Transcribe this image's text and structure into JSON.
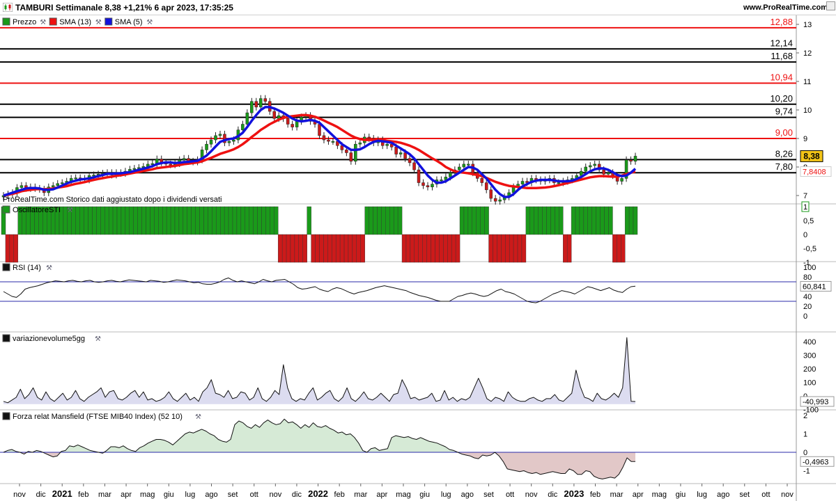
{
  "header": {
    "title": "TAMBURI Settimanale 8,38 +1,21% 6 apr 2023, 17:35:25",
    "site": "www.ProRealTime.com"
  },
  "colors": {
    "red": "#ee1111",
    "blue": "#1111dd",
    "up": "#1a9a1a",
    "down": "#cc1a1a",
    "price_tag_bg": "#f2c418",
    "vol_fill": "#dcdcf0",
    "pos_fill": "#d6ead6",
    "neg_fill": "#e2c8c8"
  },
  "panels": {
    "price": {
      "legend": [
        {
          "icon": "candlestick-icon",
          "label": "Prezzo"
        },
        {
          "icon": "red-square-icon",
          "label": "SMA (13)"
        },
        {
          "icon": "blue-square-icon",
          "label": "SMA (5)"
        }
      ],
      "note": "ProRealTime.com Storico dati aggiustato dopo i dividendi versati"
    },
    "sti": {
      "label": "OscillatoreSTI",
      "tag": "1"
    },
    "rsi": {
      "label": "RSI (14)",
      "tag": "60,841"
    },
    "vol": {
      "label": "variazionevolume5gg",
      "tag": "-40,993"
    },
    "mansfield": {
      "label": "Forza relat Mansfield (FTSE MIB40 Index) (52 10)",
      "tag": "-0,4963"
    }
  },
  "chart_data": [
    {
      "type": "candlestick",
      "name": "Prezzo",
      "ylim": [
        6.4,
        13.1
      ],
      "y_ticks": [
        "13",
        "12",
        "11",
        "10",
        "9",
        "8",
        "7"
      ],
      "horizontal_levels": [
        {
          "value": 12.88,
          "label": "12,88",
          "color": "red"
        },
        {
          "value": 12.14,
          "label": "12,14",
          "color": "black"
        },
        {
          "value": 11.68,
          "label": "11,68",
          "color": "black"
        },
        {
          "value": 10.94,
          "label": "10,94",
          "color": "red"
        },
        {
          "value": 10.2,
          "label": "10,20",
          "color": "black"
        },
        {
          "value": 9.74,
          "label": "9,74",
          "color": "black"
        },
        {
          "value": 9.0,
          "label": "9,00",
          "color": "red"
        },
        {
          "value": 8.26,
          "label": "8,26",
          "color": "black"
        },
        {
          "value": 7.8,
          "label": "7,80",
          "color": "black"
        }
      ],
      "last_price": "8,38",
      "sma13_last": "7,8408",
      "sma5_last": "7,9420",
      "close": [
        7.0,
        7.05,
        7.1,
        7.28,
        7.35,
        7.25,
        7.3,
        7.25,
        7.22,
        7.1,
        7.3,
        7.35,
        7.42,
        7.45,
        7.5,
        7.6,
        7.62,
        7.6,
        7.55,
        7.7,
        7.72,
        7.75,
        7.78,
        7.8,
        7.72,
        7.8,
        7.78,
        7.85,
        7.92,
        7.95,
        7.98,
        8.02,
        8.1,
        8.12,
        8.28,
        8.15,
        8.1,
        8.08,
        8.12,
        8.25,
        8.3,
        8.2,
        8.18,
        8.25,
        8.6,
        8.8,
        8.95,
        9.1,
        9.15,
        8.85,
        8.9,
        8.95,
        9.3,
        9.5,
        9.9,
        10.3,
        10.1,
        10.4,
        10.3,
        9.95,
        9.7,
        9.8,
        9.7,
        9.5,
        9.4,
        9.6,
        9.75,
        9.8,
        9.6,
        9.5,
        9.1,
        8.95,
        8.9,
        8.9,
        8.75,
        8.6,
        8.5,
        8.2,
        8.8,
        8.85,
        9.05,
        9.0,
        8.85,
        8.95,
        8.75,
        8.8,
        8.7,
        8.45,
        8.5,
        8.3,
        8.15,
        7.9,
        7.45,
        7.35,
        7.3,
        7.4,
        7.55,
        7.55,
        7.65,
        7.8,
        7.9,
        8.0,
        8.1,
        8.1,
        7.8,
        7.6,
        7.45,
        7.2,
        6.9,
        6.8,
        6.85,
        6.95,
        7.1,
        7.3,
        7.4,
        7.5,
        7.45,
        7.6,
        7.55,
        7.5,
        7.55,
        7.6,
        7.45,
        7.45,
        7.5,
        7.55,
        7.6,
        7.7,
        7.85,
        8.0,
        8.05,
        8.1,
        7.9,
        7.75,
        7.8,
        7.7,
        7.5,
        7.6,
        8.25,
        8.2,
        8.38
      ],
      "sma13": [
        7.0,
        7.03,
        7.06,
        7.1,
        7.15,
        7.18,
        7.2,
        7.22,
        7.23,
        7.22,
        7.23,
        7.25,
        7.28,
        7.3,
        7.33,
        7.37,
        7.41,
        7.44,
        7.47,
        7.51,
        7.55,
        7.58,
        7.61,
        7.64,
        7.66,
        7.69,
        7.71,
        7.74,
        7.77,
        7.8,
        7.83,
        7.86,
        7.89,
        7.92,
        7.96,
        7.98,
        8.0,
        8.02,
        8.04,
        8.07,
        8.1,
        8.12,
        8.14,
        8.16,
        8.2,
        8.26,
        8.32,
        8.39,
        8.46,
        8.51,
        8.56,
        8.62,
        8.7,
        8.8,
        8.92,
        9.05,
        9.17,
        9.3,
        9.4,
        9.5,
        9.58,
        9.66,
        9.72,
        9.76,
        9.78,
        9.8,
        9.82,
        9.82,
        9.8,
        9.76,
        9.7,
        9.63,
        9.55,
        9.48,
        9.4,
        9.3,
        9.2,
        9.1,
        9.03,
        8.98,
        8.95,
        8.95,
        8.95,
        8.95,
        8.95,
        8.92,
        8.9,
        8.88,
        8.85,
        8.8,
        8.75,
        8.68,
        8.6,
        8.5,
        8.4,
        8.3,
        8.22,
        8.12,
        8.0,
        7.92,
        7.85,
        7.82,
        7.8,
        7.78,
        7.75,
        7.72,
        7.68,
        7.62,
        7.55,
        7.48,
        7.43,
        7.38,
        7.34,
        7.32,
        7.3,
        7.28,
        7.26,
        7.26,
        7.26,
        7.27,
        7.28,
        7.3,
        7.33,
        7.36,
        7.4,
        7.44,
        7.48,
        7.52,
        7.56,
        7.6,
        7.64,
        7.66,
        7.68,
        7.68,
        7.67,
        7.66,
        7.66,
        7.7,
        7.75,
        7.8,
        7.84
      ],
      "sma5": [
        7.0,
        7.05,
        7.1,
        7.15,
        7.2,
        7.25,
        7.26,
        7.26,
        7.25,
        7.2,
        7.2,
        7.22,
        7.28,
        7.35,
        7.42,
        7.48,
        7.52,
        7.56,
        7.58,
        7.6,
        7.64,
        7.68,
        7.72,
        7.76,
        7.76,
        7.77,
        7.78,
        7.8,
        7.82,
        7.86,
        7.9,
        7.94,
        7.98,
        8.03,
        8.1,
        8.14,
        8.16,
        8.16,
        8.14,
        8.15,
        8.17,
        8.18,
        8.2,
        8.22,
        8.3,
        8.4,
        8.55,
        8.72,
        8.88,
        8.94,
        8.98,
        9.0,
        9.08,
        9.2,
        9.4,
        9.62,
        9.82,
        10.0,
        10.1,
        10.1,
        10.05,
        9.98,
        9.9,
        9.8,
        9.7,
        9.63,
        9.6,
        9.62,
        9.65,
        9.62,
        9.55,
        9.4,
        9.25,
        9.1,
        8.95,
        8.8,
        8.7,
        8.6,
        8.6,
        8.62,
        8.7,
        8.8,
        8.88,
        8.92,
        8.9,
        8.88,
        8.85,
        8.75,
        8.65,
        8.55,
        8.45,
        8.3,
        8.1,
        7.9,
        7.7,
        7.55,
        7.45,
        7.45,
        7.5,
        7.6,
        7.7,
        7.8,
        7.9,
        8.0,
        7.98,
        7.9,
        7.75,
        7.6,
        7.4,
        7.2,
        7.05,
        6.95,
        6.95,
        7.05,
        7.2,
        7.32,
        7.4,
        7.48,
        7.52,
        7.55,
        7.55,
        7.55,
        7.53,
        7.5,
        7.5,
        7.5,
        7.52,
        7.58,
        7.65,
        7.75,
        7.85,
        7.92,
        7.95,
        7.95,
        7.9,
        7.82,
        7.72,
        7.68,
        7.7,
        7.8,
        7.94
      ]
    },
    {
      "type": "bar",
      "name": "OscillatoreSTI",
      "ylim": [
        -1.1,
        1.1
      ],
      "y_ticks": [
        "1",
        "0,5",
        "0",
        "-0,5",
        "-1"
      ],
      "values": [
        1,
        -1,
        -1,
        -1,
        1,
        1,
        1,
        1,
        1,
        1,
        1,
        1,
        1,
        1,
        1,
        1,
        1,
        1,
        1,
        1,
        1,
        1,
        1,
        1,
        1,
        1,
        1,
        1,
        1,
        1,
        1,
        1,
        1,
        1,
        1,
        1,
        1,
        1,
        1,
        1,
        1,
        1,
        1,
        1,
        1,
        1,
        1,
        1,
        1,
        1,
        1,
        1,
        1,
        1,
        1,
        1,
        1,
        1,
        1,
        1,
        1,
        1,
        1,
        1,
        1,
        1,
        1,
        -1,
        -1,
        -1,
        -1,
        -1,
        -1,
        -1,
        1,
        -1,
        -1,
        -1,
        -1,
        -1,
        -1,
        -1,
        -1,
        -1,
        -1,
        -1,
        -1,
        -1,
        1,
        1,
        1,
        1,
        1,
        1,
        1,
        1,
        1,
        -1,
        -1,
        -1,
        -1,
        -1,
        -1,
        -1,
        -1,
        -1,
        -1,
        -1,
        -1,
        -1,
        -1,
        1,
        1,
        1,
        1,
        1,
        1,
        1,
        -1,
        -1,
        -1,
        -1,
        -1,
        -1,
        -1,
        -1,
        -1,
        1,
        1,
        1,
        1,
        1,
        1,
        1,
        1,
        1,
        -1,
        -1,
        1,
        1,
        1,
        1,
        1,
        1,
        1,
        1,
        1,
        1,
        -1,
        -1,
        -1,
        1,
        1,
        1
      ]
    },
    {
      "type": "line",
      "name": "RSI (14)",
      "ylim": [
        0,
        100
      ],
      "y_ticks": [
        "100",
        "80",
        "60",
        "40",
        "20",
        "0"
      ],
      "bands": [
        70,
        30
      ],
      "values": [
        50,
        45,
        40,
        38,
        45,
        55,
        58,
        60,
        62,
        65,
        68,
        70,
        72,
        71,
        70,
        72,
        73,
        71,
        70,
        72,
        73,
        70,
        69,
        70,
        72,
        73,
        71,
        70,
        72,
        74,
        73,
        72,
        71,
        70,
        73,
        72,
        71,
        69,
        70,
        72,
        74,
        73,
        72,
        70,
        68,
        69,
        66,
        65,
        65,
        67,
        70,
        75,
        78,
        73,
        70,
        72,
        70,
        68,
        66,
        70,
        75,
        72,
        70,
        73,
        74,
        75,
        70,
        65,
        58,
        55,
        56,
        58,
        60,
        55,
        52,
        50,
        55,
        58,
        56,
        52,
        48,
        45,
        48,
        50,
        52,
        55,
        58,
        60,
        62,
        60,
        58,
        56,
        54,
        52,
        48,
        45,
        42,
        40,
        38,
        35,
        32,
        30,
        30,
        30,
        35,
        40,
        42,
        45,
        47,
        45,
        42,
        40,
        42,
        47,
        52,
        55,
        50,
        48,
        45,
        40,
        35,
        30,
        28,
        27,
        30,
        35,
        40,
        45,
        48,
        52,
        50,
        48,
        45,
        50,
        55,
        60,
        58,
        55,
        52,
        55,
        58,
        53,
        50,
        48,
        55,
        60,
        61
      ]
    },
    {
      "type": "area",
      "name": "variazionevolume5gg",
      "ylim": [
        -60,
        450
      ],
      "y_ticks": [
        "400",
        "300",
        "200",
        "100",
        "0",
        "-100"
      ],
      "values": [
        -40,
        -50,
        -30,
        -10,
        50,
        -20,
        10,
        60,
        -10,
        -30,
        30,
        -20,
        -40,
        -10,
        20,
        -30,
        -10,
        40,
        -20,
        -40,
        -10,
        10,
        30,
        60,
        -10,
        30,
        40,
        -20,
        -30,
        -10,
        20,
        40,
        -10,
        30,
        -30,
        -20,
        -40,
        -30,
        -10,
        30,
        -20,
        -40,
        -10,
        20,
        -30,
        -10,
        -40,
        30,
        60,
        120,
        20,
        10,
        -10,
        40,
        -20,
        -10,
        30,
        20,
        -30,
        -10,
        60,
        -20,
        -40,
        -10,
        40,
        10,
        230,
        60,
        -20,
        -40,
        -20,
        -30,
        20,
        60,
        -30,
        -10,
        20,
        40,
        -20,
        -40,
        -10,
        60,
        -20,
        -40,
        -10,
        30,
        -20,
        -30,
        -10,
        20,
        -10,
        -40,
        10,
        20,
        120,
        60,
        -20,
        -10,
        -30,
        -20,
        -10,
        20,
        -40,
        -30,
        40,
        -30,
        -10,
        -40,
        -20,
        -30,
        -10,
        60,
        130,
        60,
        -20,
        -40,
        -10,
        -20,
        -40,
        30,
        -10,
        -30,
        -40,
        -40,
        -20,
        -10,
        -30,
        -40,
        -20,
        -20,
        10,
        -30,
        -40,
        -10,
        20,
        190,
        70,
        -10,
        -20,
        -40,
        20,
        -20,
        -30,
        -10,
        20,
        -10,
        60,
        430,
        -40,
        -41
      ]
    },
    {
      "type": "area",
      "name": "Forza relat Mansfield (FTSE MIB40 Index) (52 10)",
      "ylim": [
        -1.7,
        2.3
      ],
      "y_ticks": [
        "2",
        "1",
        "0",
        "-1"
      ],
      "values": [
        0.0,
        0.1,
        0.15,
        0.05,
        0.0,
        -0.1,
        0.05,
        0.0,
        0.1,
        0.05,
        -0.05,
        -0.15,
        -0.25,
        -0.2,
        0.05,
        0.1,
        0.35,
        0.3,
        0.4,
        0.3,
        0.2,
        0.1,
        0.05,
        0.0,
        -0.05,
        0.1,
        0.3,
        0.3,
        0.25,
        0.35,
        0.2,
        0.1,
        0.05,
        0.25,
        0.35,
        0.5,
        0.6,
        0.7,
        0.7,
        0.65,
        0.55,
        0.4,
        0.6,
        0.8,
        1.0,
        1.1,
        1.05,
        1.15,
        1.25,
        1.15,
        1.0,
        0.9,
        0.7,
        0.6,
        0.55,
        0.7,
        1.5,
        1.7,
        1.6,
        1.4,
        1.3,
        1.5,
        1.35,
        1.6,
        1.75,
        1.6,
        1.5,
        1.55,
        1.8,
        1.6,
        1.65,
        1.5,
        1.3,
        1.5,
        1.35,
        1.6,
        1.4,
        1.35,
        1.45,
        1.3,
        1.2,
        1.05,
        1.1,
        0.95,
        1.0,
        0.8,
        0.5,
        0.1,
        0.0,
        0.2,
        0.25,
        0.1,
        0.15,
        0.2,
        0.8,
        0.9,
        0.85,
        0.8,
        0.85,
        0.75,
        0.7,
        0.8,
        0.7,
        0.6,
        0.55,
        0.5,
        0.4,
        0.3,
        0.15,
        0.1,
        0.0,
        -0.1,
        -0.15,
        -0.2,
        -0.3,
        -0.35,
        -0.15,
        -0.2,
        -0.15,
        0.0,
        -0.2,
        -0.5,
        -0.9,
        -0.95,
        -1.0,
        -1.05,
        -1.0,
        -1.1,
        -1.15,
        -1.1,
        -1.2,
        -1.15,
        -1.1,
        -1.05,
        -1.1,
        -1.15,
        -1.15,
        -0.9,
        -1.0,
        -1.2,
        -1.2,
        -1.0,
        -1.05,
        -1.3,
        -1.4,
        -1.45,
        -1.4,
        -1.35,
        -1.4,
        -1.2,
        -0.8,
        -0.3,
        -0.5,
        -0.5
      ]
    }
  ],
  "x_axis": {
    "labels": [
      "nov",
      "dic",
      "2021",
      "feb",
      "mar",
      "apr",
      "mag",
      "giu",
      "lug",
      "ago",
      "set",
      "ott",
      "nov",
      "dic",
      "2022",
      "feb",
      "mar",
      "apr",
      "mag",
      "giu",
      "lug",
      "ago",
      "set",
      "ott",
      "nov",
      "dic",
      "2023",
      "feb",
      "mar",
      "apr",
      "mag",
      "giu",
      "lug",
      "ago",
      "set",
      "ott",
      "nov"
    ],
    "bold": [
      "2021",
      "2022",
      "2023"
    ]
  }
}
